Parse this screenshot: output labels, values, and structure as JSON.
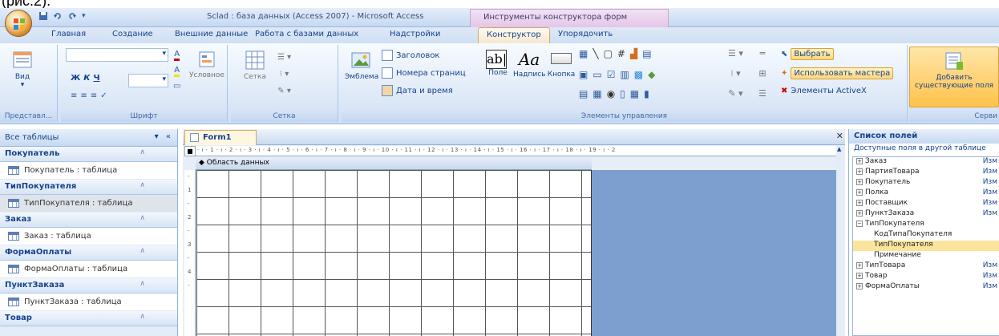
{
  "top_fragment": "(рис.2).",
  "window": {
    "title": "Sclad : база данных (Access 2007) - Microsoft Access",
    "context_tab": "Инструменты конструктора форм"
  },
  "tabs": [
    "Главная",
    "Создание",
    "Внешние данные",
    "Работа с базами данных",
    "Надстройки",
    "Конструктор",
    "Упорядочить"
  ],
  "ribbon": {
    "views": {
      "view_label": "Вид",
      "group": "Представл..."
    },
    "font": {
      "bold": "Ж",
      "italic": "К",
      "underline": "Ч",
      "cond_format": "Условное",
      "group": "Шрифт"
    },
    "grid": {
      "grid_label": "Сетка",
      "group": "Сетка"
    },
    "controls": {
      "logo": "Эмблема",
      "title": "Заголовок",
      "page_numbers": "Номера страниц",
      "date_time": "Дата и время",
      "field": "Поле",
      "label": "Надпись",
      "button": "Кнопка",
      "select": "Выбрать",
      "use_wizards": "Использовать мастера",
      "activex": "Элементы ActiveX",
      "group": "Элементы управления"
    },
    "tools": {
      "add_fields_1": "Добавить",
      "add_fields_2": "существующие поля",
      "group": "Серви"
    }
  },
  "nav": {
    "header": "Все таблицы",
    "groups": [
      {
        "name": "Покупатель",
        "item": "Покупатель : таблица"
      },
      {
        "name": "ТипПокупателя",
        "item": "ТипПокупателя : таблица"
      },
      {
        "name": "Заказ",
        "item": "Заказ : таблица"
      },
      {
        "name": "ФормаОплаты",
        "item": "ФормаОплаты : таблица"
      },
      {
        "name": "ПунктЗаказа",
        "item": "ПунктЗаказа : таблица"
      },
      {
        "name": "Товар",
        "item": ""
      }
    ],
    "selected_index": 1
  },
  "document": {
    "tab": "Form1",
    "section": "Область данных",
    "ruler_numbers": "· ı · 1 · ı · 2 · ı · 3 · ı · 4 · ı · 5 · ı · 6 · ı · 7 · ı · 8 · ı · 9 · ı · 10 · ı · 11 · ı · 12 · ı · 13 · ı · 14 · ı · 15 · ı · 16 · ı · 17 · ı · 18 · ı · 19 · ı · 2",
    "vruler": [
      "-",
      "1",
      "-",
      "2",
      "-",
      "3",
      "-",
      "4",
      "-"
    ]
  },
  "field_list": {
    "title": "Список полей",
    "subtitle": "Доступные поля в другой таблице",
    "edit_label": "Изм",
    "tables": [
      {
        "name": "Заказ",
        "expanded": false
      },
      {
        "name": "ПартияТовара",
        "expanded": false
      },
      {
        "name": "Покупатель",
        "expanded": false
      },
      {
        "name": "Полка",
        "expanded": false
      },
      {
        "name": "Поставщик",
        "expanded": false
      },
      {
        "name": "ПунктЗаказа",
        "expanded": false
      },
      {
        "name": "ТипПокупателя",
        "expanded": true,
        "fields": [
          "КодТипаПокупателя",
          "ТипПокупателя",
          "Примечание"
        ],
        "selected_field": 1
      },
      {
        "name": "ТипТовара",
        "expanded": false
      },
      {
        "name": "Товар",
        "expanded": false
      },
      {
        "name": "ФормаОплаты",
        "expanded": false
      }
    ]
  }
}
